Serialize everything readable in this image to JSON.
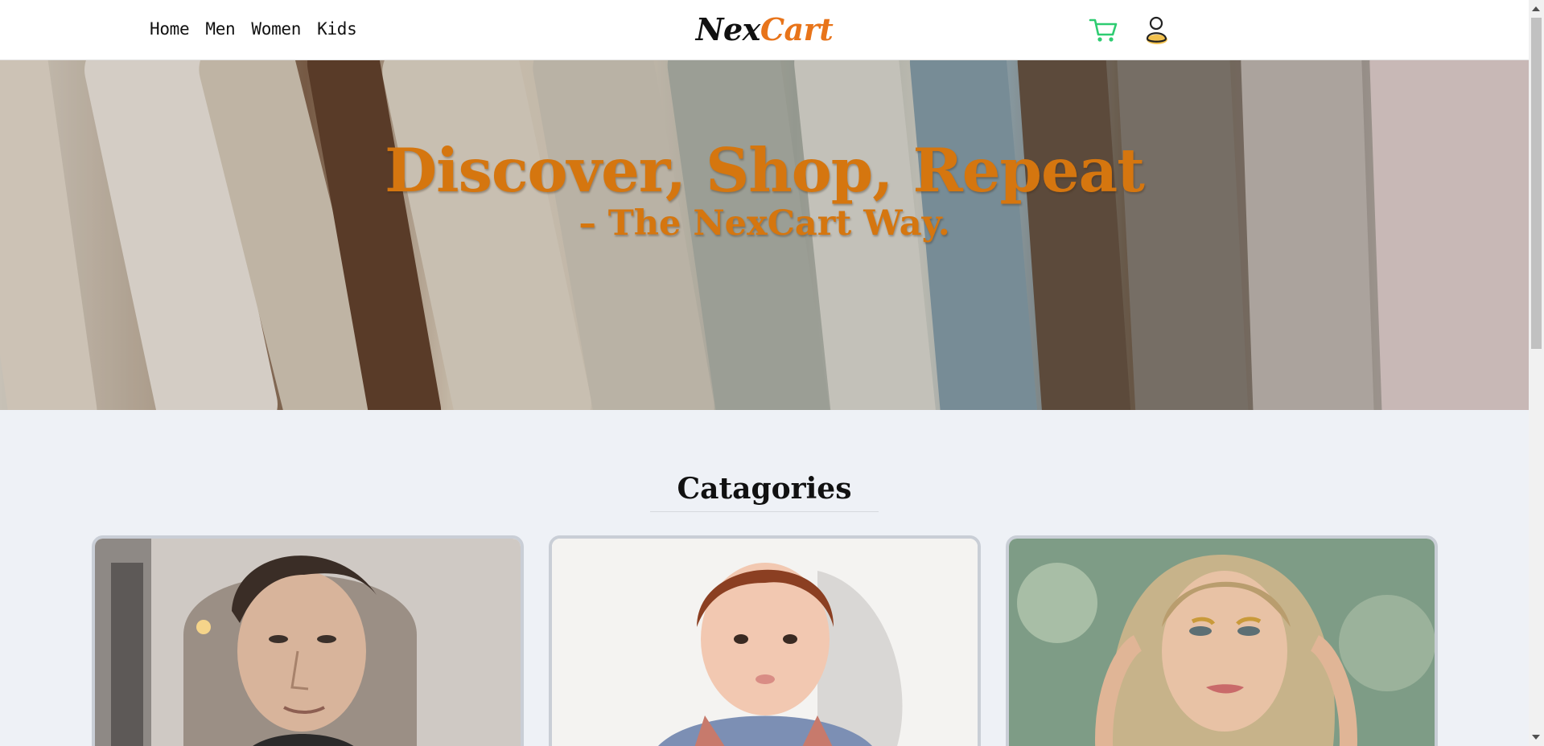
{
  "nav": {
    "links": [
      "Home",
      "Men",
      "Women",
      "Kids"
    ],
    "icons": {
      "cart": "cart-icon",
      "user": "user-icon"
    },
    "cart_color": "#2ecc71",
    "user_accent": "#f2c14e"
  },
  "logo": {
    "part1": "Nex",
    "part2": "Cart"
  },
  "hero": {
    "title": "Discover, Shop, Repeat",
    "subtitle": "– The NexCart Way."
  },
  "categories": {
    "title": "Catagories"
  },
  "colors": {
    "accent": "#e8741a",
    "hero_text": "#d5760f",
    "page_bg": "#eef1f6"
  }
}
